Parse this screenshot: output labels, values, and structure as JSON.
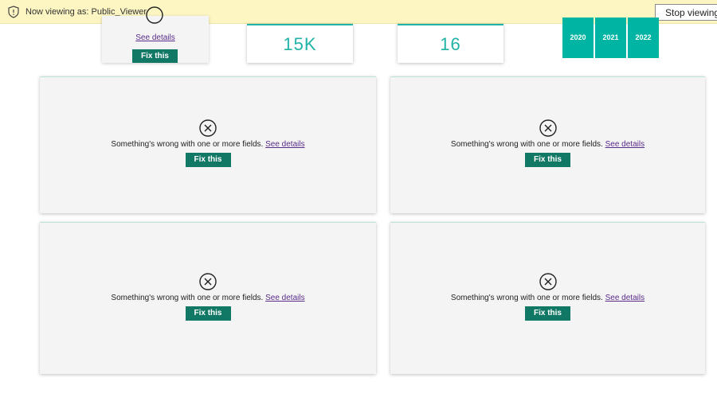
{
  "banner": {
    "text": "Now viewing as: Public_Viewer",
    "stop_label": "Stop viewing"
  },
  "top_error": {
    "link": "See details",
    "fix_label": "Fix this"
  },
  "kpis": [
    {
      "value": "15K"
    },
    {
      "value": "16"
    }
  ],
  "year_slicer": [
    "2020",
    "2021",
    "2022"
  ],
  "error_panels": [
    {
      "message": "Something's wrong with one or more fields.",
      "link": "See details",
      "fix_label": "Fix this"
    },
    {
      "message": "Something's wrong with one or more fields.",
      "link": "See details",
      "fix_label": "Fix this"
    },
    {
      "message": "Something's wrong with one or more fields.",
      "link": "See details",
      "fix_label": "Fix this"
    },
    {
      "message": "Something's wrong with one or more fields.",
      "link": "See details",
      "fix_label": "Fix this"
    }
  ],
  "colors": {
    "accent": "#21b3a7",
    "fix_button": "#117865",
    "banner": "#fdf6c3",
    "link": "#5a2b8a"
  }
}
